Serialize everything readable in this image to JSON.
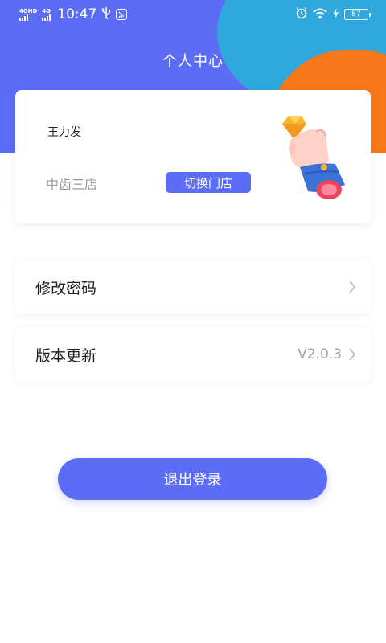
{
  "status_bar": {
    "network_1": "4GHD",
    "network_2": "4G",
    "time": "10:47",
    "battery": "87"
  },
  "header": {
    "title": "个人中心"
  },
  "profile": {
    "user_name": "王力发",
    "store_name": "中齿三店",
    "switch_store_label": "切换门店"
  },
  "menu": {
    "change_password_label": "修改密码",
    "version_label": "版本更新",
    "version_value": "V2.0.3"
  },
  "logout": {
    "label": "退出登录"
  },
  "colors": {
    "primary": "#5b6cf5",
    "header_cyan": "#2fa8dd",
    "header_orange": "#f87718"
  },
  "icons": [
    "signal-icon",
    "usb-icon",
    "app-badge-icon",
    "alarm-icon",
    "wifi-icon",
    "charging-icon",
    "battery-icon",
    "chevron-right-icon"
  ]
}
